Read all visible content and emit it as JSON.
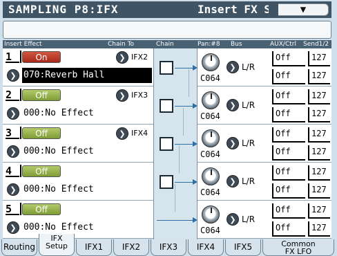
{
  "title": {
    "mode_page": "SAMPLING P8:IFX",
    "page_name": "Insert FX Setup",
    "menu_icon": "dropdown-triangle"
  },
  "columns": {
    "insert_effect": "Insert Effect",
    "chain_to": "Chain To",
    "chain": "Chain",
    "pan": "Pan:#8",
    "bus": "Bus",
    "aux_ctrl": "AUX/Ctrl",
    "send": "Send1/2"
  },
  "slots": [
    {
      "num": "1",
      "toggle": "On",
      "chain_to": "IFX2",
      "effect": "070:Reverb Hall",
      "pan": "C064",
      "bus": "L/R",
      "aux1": "Off",
      "aux2": "Off",
      "send1": "127",
      "send2": "127"
    },
    {
      "num": "2",
      "toggle": "Off",
      "chain_to": "IFX3",
      "effect": "000:No Effect",
      "pan": "C064",
      "bus": "L/R",
      "aux1": "Off",
      "aux2": "Off",
      "send1": "127",
      "send2": "127"
    },
    {
      "num": "3",
      "toggle": "Off",
      "chain_to": "IFX4",
      "effect": "000:No Effect",
      "pan": "C064",
      "bus": "L/R",
      "aux1": "Off",
      "aux2": "Off",
      "send1": "127",
      "send2": "127"
    },
    {
      "num": "4",
      "toggle": "Off",
      "chain_to": "",
      "effect": "000:No Effect",
      "pan": "C064",
      "bus": "L/R",
      "aux1": "Off",
      "aux2": "Off",
      "send1": "127",
      "send2": "127"
    },
    {
      "num": "5",
      "toggle": "Off",
      "chain_to": "",
      "effect": "000:No Effect",
      "pan": "C064",
      "bus": "L/R",
      "aux1": "Off",
      "aux2": "Off",
      "send1": "127",
      "send2": "127"
    }
  ],
  "tabs": [
    {
      "line1": "Routing",
      "line2": ""
    },
    {
      "line1": "IFX",
      "line2": "Setup"
    },
    {
      "line1": "IFX1",
      "line2": ""
    },
    {
      "line1": "IFX2",
      "line2": ""
    },
    {
      "line1": "IFX3",
      "line2": ""
    },
    {
      "line1": "IFX4",
      "line2": ""
    },
    {
      "line1": "IFX5",
      "line2": ""
    },
    {
      "line1": "Common",
      "line2": "FX LFO"
    }
  ],
  "active_tab": "IFX Setup",
  "colors": {
    "title_bg": "#3f5566",
    "on": "#c0402e",
    "off": "#9cb553",
    "screen": "#cfe0ec"
  }
}
